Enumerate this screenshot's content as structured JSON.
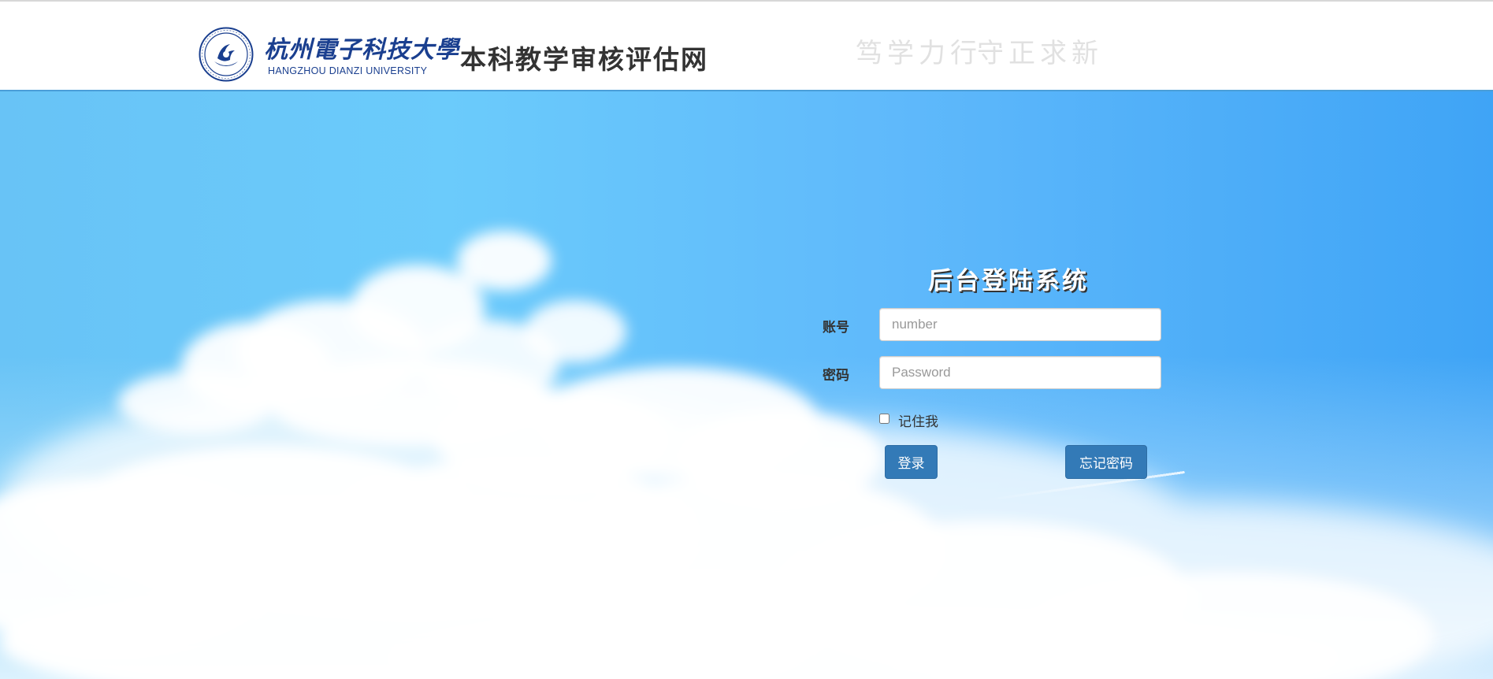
{
  "header": {
    "university_name_cn": "杭州電子科技大學",
    "university_name_en": "HANGZHOU DIANZI UNIVERSITY",
    "site_title": "本科教学审核评估网",
    "motto_left": "笃学力行",
    "motto_right": "守正求新",
    "colors": {
      "brand_blue": "#1a3f8f",
      "header_border": "#4a9ed8"
    }
  },
  "login": {
    "title": "后台登陆系统",
    "account": {
      "label": "账号",
      "placeholder": "number",
      "value": ""
    },
    "password": {
      "label": "密码",
      "placeholder": "Password",
      "value": ""
    },
    "remember": {
      "label": "记住我",
      "checked": false
    },
    "login_button": "登录",
    "forgot_button": "忘记密码",
    "colors": {
      "button": "#337ab7"
    }
  },
  "background": {
    "scene": "blue sky with white clouds",
    "colors": {
      "sky_light": "#6bcbfb",
      "sky_deep": "#3fa4f6"
    }
  }
}
